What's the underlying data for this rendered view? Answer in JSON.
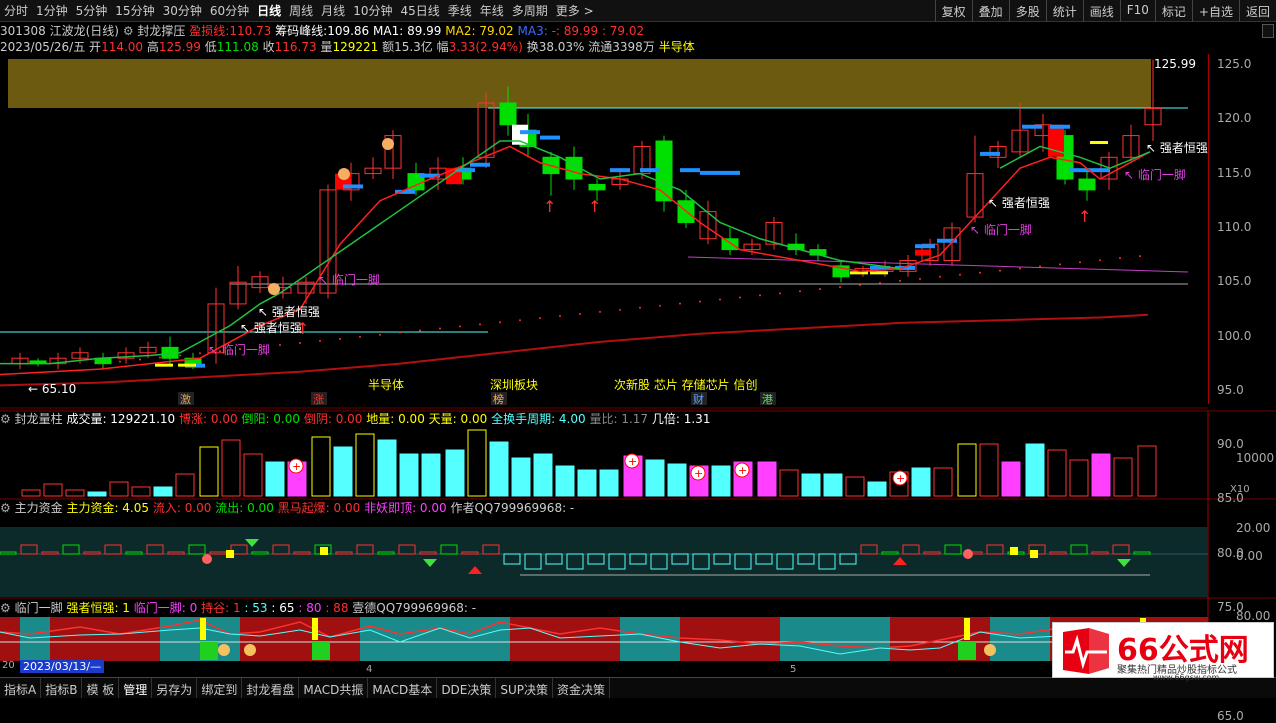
{
  "toolbar": {
    "periods": [
      "分时",
      "1分钟",
      "5分钟",
      "15分钟",
      "30分钟",
      "60分钟",
      "日线",
      "周线",
      "月线",
      "10分钟",
      "45日线",
      "季线",
      "年线",
      "多周期",
      "更多 >"
    ],
    "active": "日线",
    "right": [
      "复权",
      "叠加",
      "多股",
      "统计",
      "画线",
      "F10",
      "标记",
      "+自选",
      "返回"
    ]
  },
  "header": {
    "code": "301308 江波龙(日线)",
    "ind": "封龙撑压",
    "yk_label": "盈损线:",
    "yk_val": "110.73",
    "cm_label": "筹码峰线:",
    "cm_val": "109.86",
    "ma1": "MA1: 89.99",
    "ma2": "MA2: 79.02",
    "ma3": "MA3: -",
    "ma3_rest": ": 89.99 : 79.02",
    "date": "2023/05/26/五",
    "open_l": "开",
    "open": "114.00",
    "high_l": "高",
    "high": "125.99",
    "low_l": "低",
    "low": "111.08",
    "close_l": "收",
    "close": "116.73",
    "vol_l": "量",
    "vol": "129221",
    "amt": "额15.3亿",
    "chg_l": "幅",
    "chg": "3.33(2.94%)",
    "turn": "换38.03%",
    "float": "流通3398万",
    "sector": "半导体"
  },
  "price_axis": [
    "125.0",
    "120.0",
    "115.0",
    "110.0",
    "105.0",
    "100.0",
    "95.0",
    "90.0",
    "85.0",
    "80.0",
    "75.0",
    "70.0",
    "65.0"
  ],
  "high_label": "125.99",
  "low_label": "← 65.10",
  "annotations": [
    {
      "t": "↖ 临门一脚",
      "c": "#e040e0"
    },
    {
      "t": "↖ 强者恒强",
      "c": "#fff"
    },
    {
      "t": "↖ 强者恒强",
      "c": "#fff"
    },
    {
      "t": "↖ 临门一脚",
      "c": "#e040e0"
    },
    {
      "t": "↖ 强者恒强",
      "c": "#fff"
    },
    {
      "t": "↖ 临门一脚",
      "c": "#e040e0"
    },
    {
      "t": "↖ 强者恒强",
      "c": "#fff"
    },
    {
      "t": "↖ 临门一脚",
      "c": "#e040e0"
    }
  ],
  "sectors": [
    "半导体",
    "深圳板块",
    "次新股 芯片 存储芯片 信创"
  ],
  "event_tags": [
    "激",
    "涨",
    "榜",
    "财",
    "港"
  ],
  "vol_panel": {
    "name": "封龙量柱",
    "l1": "成交量: 129221.10",
    "l2": "博涨: 0.00",
    "l3": "倒阳: 0.00",
    "l4": "倒阴: 0.00",
    "l5": "地量: 0.00",
    "l6": "天量: 0.00",
    "l7": "全换手周期: 4.00",
    "l8": "量比: 1.17",
    "l9": "几倍: 1.31",
    "axis": "10000",
    "unit": "X10"
  },
  "fund_panel": {
    "name": "主力资金",
    "l1": "主力资金: 4.05",
    "l2": "流入: 0.00",
    "l3": "流出: 0.00",
    "l4": "黑马起爆: 0.00",
    "l5": "非妖即顶: 0.00",
    "l6": "作者QQ799969968: -",
    "ax1": "20.00",
    "ax2": "0.00"
  },
  "lm_panel": {
    "name": "临门一脚",
    "l1": "强者恒强: 1",
    "l2": "临门一脚: 0",
    "l3": "持谷: 1",
    "l4": ": 53",
    "l5": ": 65",
    "l6": ": 80",
    "l7": ": 88",
    "l8": "壹德QQ799969968: -",
    "ax1": "80.00"
  },
  "xaxis": {
    "date": "2023/03/13/—",
    "m4": "4",
    "m5": "5",
    "lead": "20"
  },
  "bottom": [
    "指标A",
    "指标B",
    "模 板",
    "管理",
    "另存为",
    "绑定到",
    "封龙看盘",
    "MACD共振",
    "MACD基本",
    "DDE决策",
    "SUP决策",
    "资金决策"
  ],
  "watermark": {
    "big": "66公式网",
    "s1": "聚集热门精品炒股指标公式",
    "s2": "www.66gsw.com"
  },
  "colors": {
    "up": "#ff3232",
    "down": "#00e000",
    "yellow": "#ffff00",
    "cyan": "#54ffff",
    "magenta": "#ff40ff",
    "blue": "#1e90ff"
  }
}
